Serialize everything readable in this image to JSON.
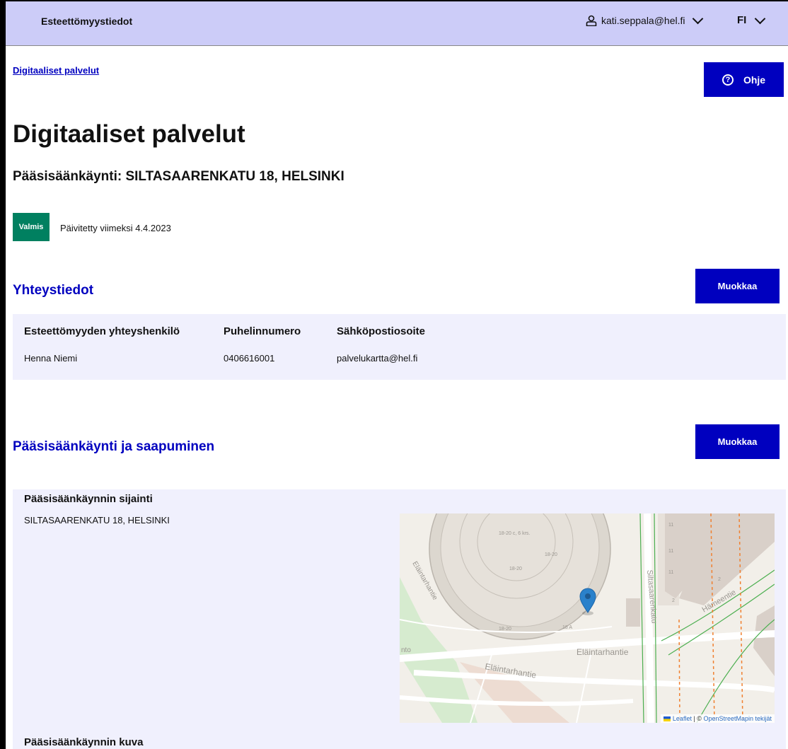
{
  "header": {
    "app_title": "Esteettömyystiedot",
    "user_email": "kati.seppala@hel.fi",
    "language": "FI"
  },
  "breadcrumb": "Digitaaliset palvelut",
  "help_label": "Ohje",
  "page": {
    "title": "Digitaaliset palvelut",
    "subtitle": "Pääsisäänkäynti: SILTASAARENKATU 18, HELSINKI",
    "status": "Valmis",
    "updated": "Päivitetty viimeksi 4.4.2023"
  },
  "contact": {
    "title": "Yhteystiedot",
    "edit_label": "Muokkaa",
    "columns": [
      "Esteettömyyden yhteyshenkilö",
      "Puhelinnumero",
      "Sähköpostiosoite"
    ],
    "values": [
      "Henna Niemi",
      "0406616001",
      "palvelukartta@hel.fi"
    ]
  },
  "entrance": {
    "title": "Pääsisäänkäynti ja saapuminen",
    "edit_label": "Muokkaa",
    "location_heading": "Pääsisäänkäynnin sijainti",
    "address": "SILTASAARENKATU 18, HELSINKI",
    "photo_heading": "Pääsisäänkäynnin kuva"
  },
  "map": {
    "attribution_leaflet": "Leaflet",
    "attribution_sep": " | © ",
    "attribution_osm": "OpenStreetMapin tekijät",
    "street_labels": [
      "Siltasaarenkatu",
      "Eläintarhantie",
      "Eläintarhantie",
      "Hämeentie",
      "Eläintarhantie"
    ],
    "building_labels": [
      "18-20 c, 6 krs.",
      "18-20",
      "18-20",
      "18-20",
      "18 A",
      "11",
      "11",
      "11",
      "2",
      "2",
      "nto"
    ],
    "marker_color": "#2a81cb"
  }
}
